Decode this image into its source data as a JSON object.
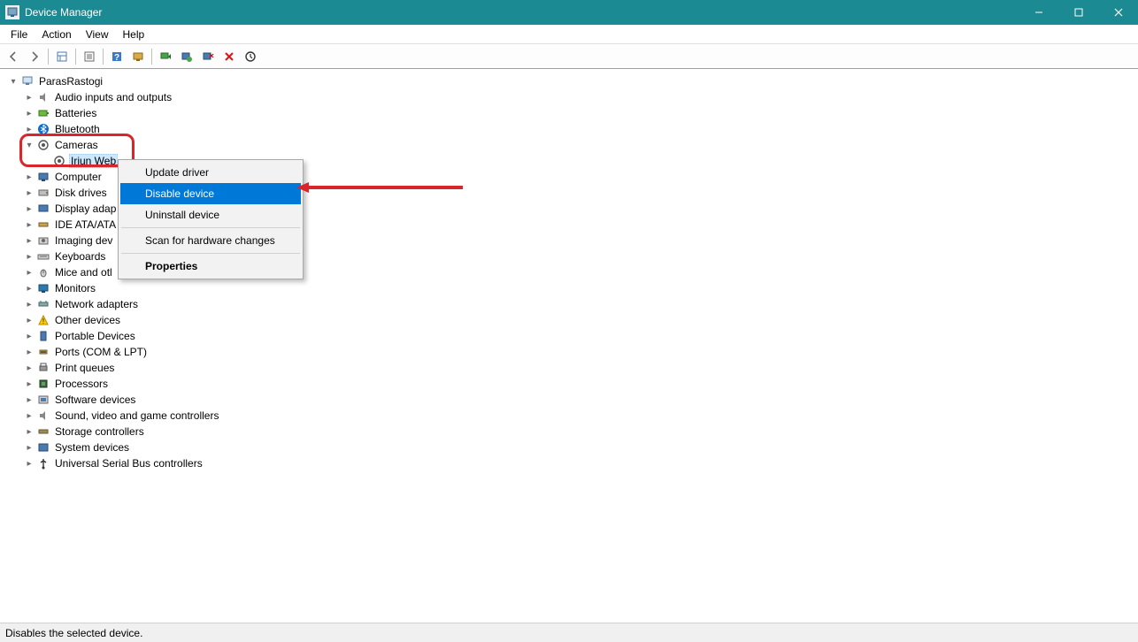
{
  "window": {
    "title": "Device Manager"
  },
  "menubar": {
    "file": "File",
    "action": "Action",
    "view": "View",
    "help": "Help"
  },
  "tree": {
    "root": "ParasRastogi",
    "items": [
      "Audio inputs and outputs",
      "Batteries",
      "Bluetooth",
      "Cameras",
      "Iriun Web",
      "Computer",
      "Disk drives",
      "Display adap",
      "IDE ATA/ATA",
      "Imaging dev",
      "Keyboards",
      "Mice and otl",
      "Monitors",
      "Network adapters",
      "Other devices",
      "Portable Devices",
      "Ports (COM & LPT)",
      "Print queues",
      "Processors",
      "Software devices",
      "Sound, video and game controllers",
      "Storage controllers",
      "System devices",
      "Universal Serial Bus controllers"
    ]
  },
  "context_menu": {
    "update": "Update driver",
    "disable": "Disable device",
    "uninstall": "Uninstall device",
    "scan": "Scan for hardware changes",
    "properties": "Properties"
  },
  "statusbar": {
    "text": "Disables the selected device."
  }
}
